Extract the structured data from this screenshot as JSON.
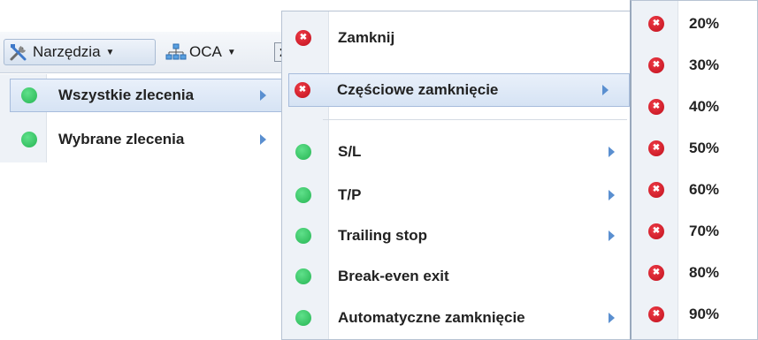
{
  "toolbar": {
    "tools_label": "Narzędzia",
    "oca_label": "OCA",
    "extra_glyph": "Σ"
  },
  "menu_level1": {
    "items": [
      {
        "label": "Wszystkie zlecenia",
        "status_color": "green"
      },
      {
        "label": "Wybrane zlecenia",
        "status_color": "green"
      }
    ]
  },
  "menu_level2": {
    "items": [
      {
        "label": "Zamknij",
        "status_color": "red"
      },
      {
        "label": "Częściowe zamknięcie",
        "status_color": "red"
      },
      {
        "label": "S/L",
        "status_color": "green"
      },
      {
        "label": "T/P",
        "status_color": "green"
      },
      {
        "label": "Trailing stop",
        "status_color": "green"
      },
      {
        "label": "Break-even exit",
        "status_color": "green"
      },
      {
        "label": "Automatyczne zamknięcie",
        "status_color": "green"
      }
    ]
  },
  "menu_level3": {
    "items": [
      "20%",
      "30%",
      "40%",
      "50%",
      "60%",
      "70%",
      "80%",
      "90%"
    ]
  },
  "colors": {
    "green_dot": "#2fbf5c",
    "red_dot": "#d91c28",
    "submenu_arrow": "#5a8fd0",
    "highlight": "#d6e3f4"
  }
}
